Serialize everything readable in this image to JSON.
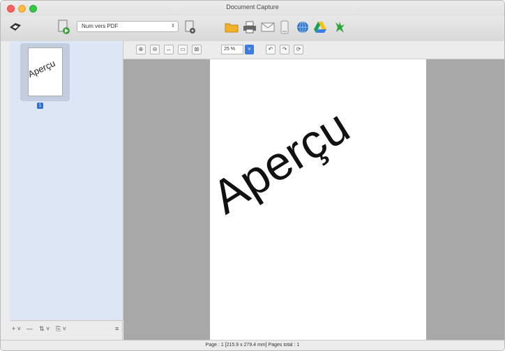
{
  "window": {
    "title": "Document Capture"
  },
  "toolbar": {
    "job_select": {
      "value": "Num vers PDF",
      "arrows": "⇕"
    },
    "icons": [
      "scan-icon",
      "job-run-icon",
      "job-settings-icon",
      "folder-icon",
      "print-icon",
      "mail-icon",
      "device-icon",
      "web-icon",
      "drive-icon",
      "evernote-icon"
    ]
  },
  "sidebar": {
    "thumbnail_text": "Aperçu",
    "page_badge": "1",
    "bottom_buttons": [
      "+ ˅",
      "—",
      "⇅ ˅",
      "⎘ ˅",
      "≡"
    ]
  },
  "view_toolbar": {
    "zoom_value": "25 %",
    "tools": [
      "zoom-in-icon",
      "zoom-out-icon",
      "fit-width-icon",
      "fit-page-icon",
      "actual-size-icon",
      "rotate-left-icon",
      "rotate-right-icon",
      "rotate-icon"
    ]
  },
  "preview": {
    "text": "Aperçu"
  },
  "status_bar": {
    "text": "Page : 1  [215.9 x 279.4 mm]  Pages total : 1"
  },
  "colors": {
    "accent": "#3c7be0",
    "sidebar_bg": "#dde6f4",
    "canvas_bg": "#a8a8a8"
  }
}
